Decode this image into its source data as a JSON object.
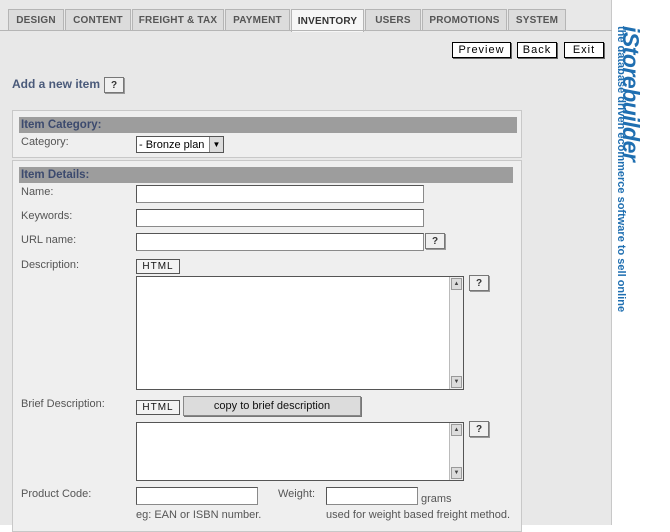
{
  "tabs": [
    {
      "label": "DESIGN",
      "active": false
    },
    {
      "label": "CONTENT",
      "active": false
    },
    {
      "label": "FREIGHT & TAX",
      "active": false
    },
    {
      "label": "PAYMENT",
      "active": false
    },
    {
      "label": "INVENTORY",
      "active": true
    },
    {
      "label": "USERS",
      "active": false
    },
    {
      "label": "PROMOTIONS",
      "active": false
    },
    {
      "label": "SYSTEM",
      "active": false
    }
  ],
  "toolbar": {
    "preview": "Preview",
    "back": "Back",
    "exit": "Exit"
  },
  "page": {
    "heading": "Add a new item",
    "help": "?"
  },
  "category": {
    "header": "Item Category:",
    "label": "Category:",
    "selected": "- Bronze plan"
  },
  "details": {
    "header": "Item Details:",
    "name_label": "Name:",
    "keywords_label": "Keywords:",
    "url_label": "URL name:",
    "description_label": "Description:",
    "brief_label": "Brief Description:",
    "html_button": "HTML",
    "copy_button": "copy to brief description",
    "product_code_label": "Product Code:",
    "product_code_hint": "eg: EAN or ISBN number.",
    "weight_label": "Weight:",
    "weight_unit": "grams",
    "weight_hint": "used for weight based freight method.",
    "help": "?"
  },
  "brand": {
    "logo": "iStorebuilder",
    "tagline": "the database driven ecommerce software to sell online",
    "color": "#1f6fb1"
  },
  "icons": {
    "select_arrow": "▼",
    "scroll_up": "▲",
    "scroll_down": "▼"
  }
}
